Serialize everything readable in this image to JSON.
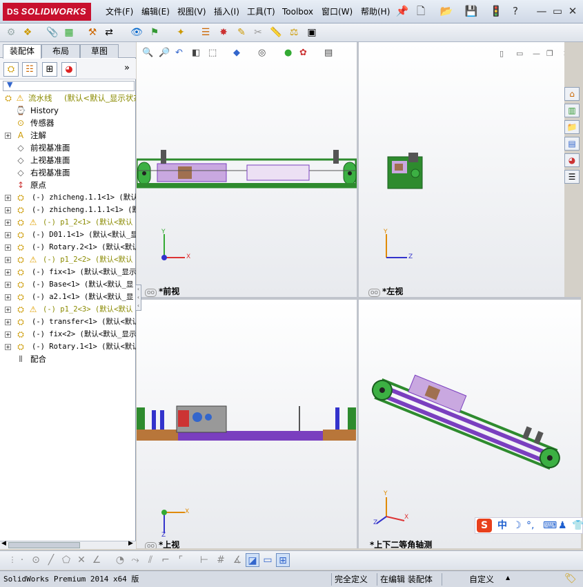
{
  "app": {
    "brand_mark": "DS",
    "brand": "SOLIDWORKS"
  },
  "menu": [
    "文件(F)",
    "编辑(E)",
    "视图(V)",
    "插入(I)",
    "工具(T)",
    "Toolbox",
    "窗口(W)",
    "帮助(H)"
  ],
  "window_controls": {
    "minimize": "—",
    "restore": "▭",
    "close": "✕"
  },
  "tabs": [
    "装配体",
    "布局",
    "草图"
  ],
  "panel_expand": "»",
  "tree": {
    "root": {
      "name": "流水线",
      "config": "(默认<默认_显示状态"
    },
    "items": [
      {
        "label": "History",
        "icon": "history-icon"
      },
      {
        "label": "传感器",
        "icon": "sensor-icon"
      },
      {
        "label": "注解",
        "icon": "annotation-icon"
      },
      {
        "label": "前视基准面",
        "icon": "plane-icon"
      },
      {
        "label": "上视基准面",
        "icon": "plane-icon"
      },
      {
        "label": "右视基准面",
        "icon": "plane-icon"
      },
      {
        "label": "原点",
        "icon": "origin-icon"
      },
      {
        "label": "(-) zhicheng.1.1<1> (默认<",
        "icon": "part-icon"
      },
      {
        "label": "(-) zhicheng.1.1.1<1> (默",
        "icon": "part-icon"
      },
      {
        "label": "(-) p1_2<1> (默认<默认",
        "icon": "warning-part-icon"
      },
      {
        "label": "(-) D01.1<1> (默认<默认_显",
        "icon": "part-icon"
      },
      {
        "label": "(-) Rotary.2<1> (默认<默认",
        "icon": "part-icon"
      },
      {
        "label": "(-) p1_2<2> (默认<默认",
        "icon": "warning-part-icon"
      },
      {
        "label": "(-) fix<1> (默认<默认_显示",
        "icon": "part-icon"
      },
      {
        "label": "(-) Base<1> (默认<默认_显",
        "icon": "part-icon"
      },
      {
        "label": "(-) a2.1<1> (默认<默认_显",
        "icon": "part-icon"
      },
      {
        "label": "(-) p1_2<3> (默认<默认",
        "icon": "warning-part-icon"
      },
      {
        "label": "(-) transfer<1> (默认<默认",
        "icon": "part-icon"
      },
      {
        "label": "(-) fix<2> (默认<默认_显示",
        "icon": "part-icon"
      },
      {
        "label": "(-) Rotary.1<1> (默认<默认",
        "icon": "part-icon"
      },
      {
        "label": "配合",
        "icon": "mates-icon"
      }
    ]
  },
  "viewports": [
    {
      "label": "*前视",
      "axes": [
        "Y",
        "X"
      ]
    },
    {
      "label": "*左视",
      "axes": [
        "Y",
        "Z"
      ]
    },
    {
      "label": "*上视",
      "axes": [
        "X",
        "Z"
      ]
    },
    {
      "label": "*上下二等角轴测",
      "axes": [
        "Y",
        "X",
        "Z"
      ]
    }
  ],
  "status": {
    "product": "SolidWorks Premium 2014 x64 版",
    "state": "完全定义",
    "mode": "在编辑 装配体",
    "custom": "自定义",
    "arrow": "▲"
  },
  "ime": {
    "logo": "S",
    "mode": "中",
    "moon": "☽",
    "punct": "°,",
    "keyboard": "⌨"
  },
  "colors": {
    "brand_red": "#c8102e",
    "warning_text": "#8a8a00",
    "frame_green": "#2e8b2e",
    "rail_purple": "#7a3fbf"
  }
}
